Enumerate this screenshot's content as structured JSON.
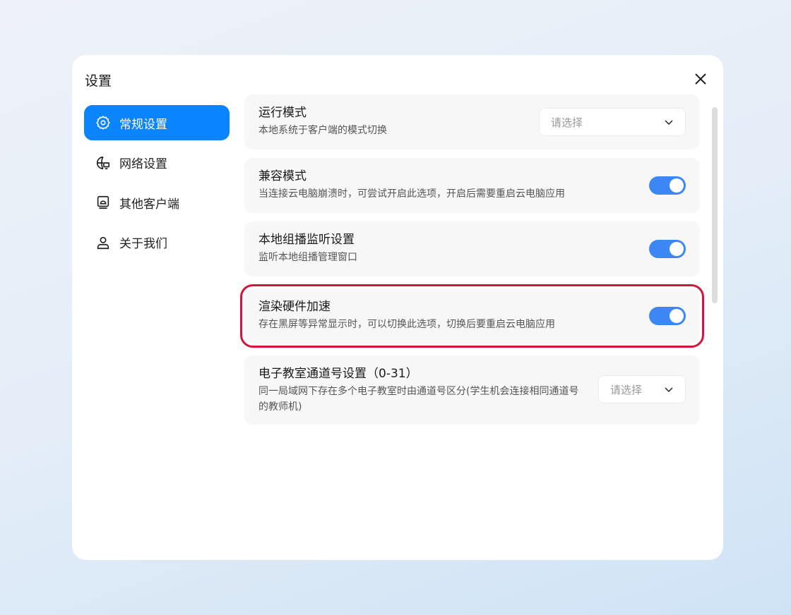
{
  "dialog": {
    "title": "设置"
  },
  "sidebar": {
    "items": [
      {
        "label": "常规设置",
        "icon": "gear-icon"
      },
      {
        "label": "网络设置",
        "icon": "network-icon"
      },
      {
        "label": "其他客户端",
        "icon": "monitor-icon"
      },
      {
        "label": "关于我们",
        "icon": "user-icon"
      }
    ]
  },
  "settings": [
    {
      "title": "运行模式",
      "desc": "本地系统于客户端的模式切换",
      "control": "select",
      "placeholder": "请选择"
    },
    {
      "title": "兼容模式",
      "desc": "当连接云电脑崩溃时，可尝试开启此选项，开启后需要重启云电脑应用",
      "control": "toggle",
      "on": true
    },
    {
      "title": "本地组播监听设置",
      "desc": "监听本地组播管理窗口",
      "control": "toggle",
      "on": true
    },
    {
      "title": "渲染硬件加速",
      "desc": "存在黑屏等异常显示时，可以切换此选项，切换后要重启云电脑应用",
      "control": "toggle",
      "on": true
    },
    {
      "title": "电子教室通道号设置（0-31）",
      "desc": "同一局域网下存在多个电子教室时由通道号区分(学生机会连接相同通道号的教师机)",
      "control": "select",
      "placeholder": "请选择"
    }
  ],
  "colors": {
    "accent": "#0a84ff",
    "toggle": "#3d87f5",
    "highlight": "#d1163a"
  }
}
